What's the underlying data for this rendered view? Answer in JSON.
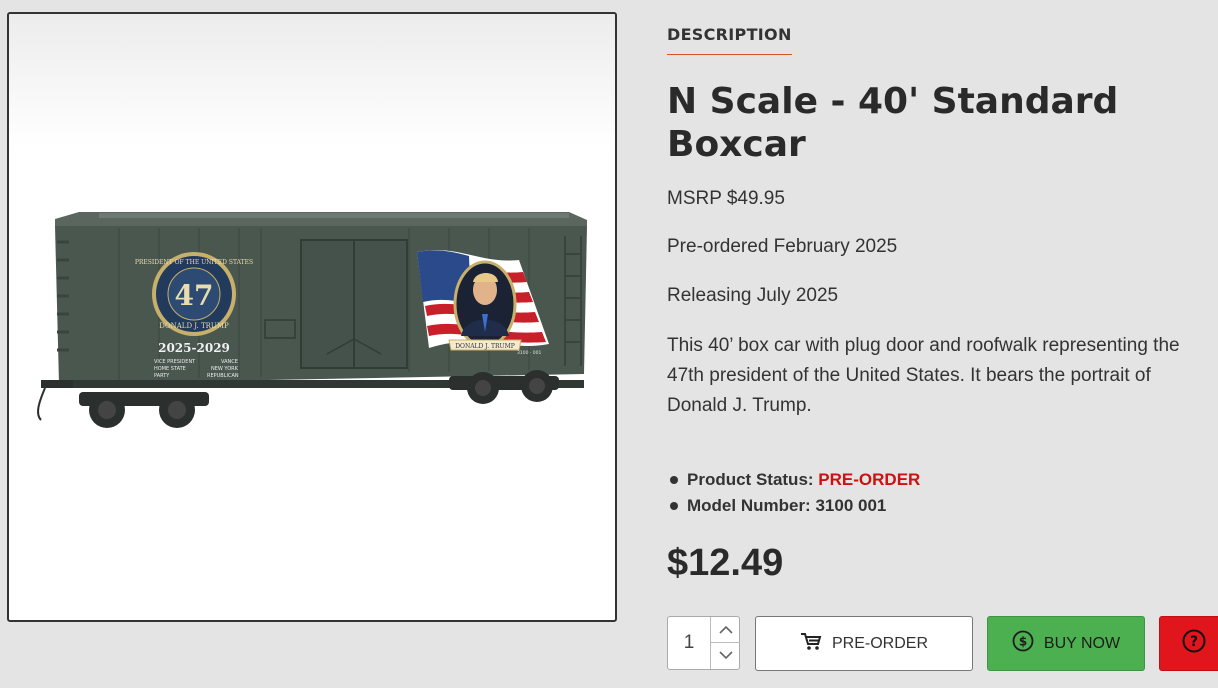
{
  "product_image": {
    "alt": "N Scale 40' Standard Boxcar",
    "car_colors": {
      "body": "#4a574f",
      "dark": "#2f3833",
      "roof": "#57645c"
    },
    "seal_number": "47",
    "seal_ring_text": "PRESIDENT OF THE UNITED STATES",
    "seal_name": "DONALD J. TRUMP",
    "term_years": "2025-2029",
    "data_left": [
      "VICE PRESIDENT",
      "HOME STATE",
      "PARTY"
    ],
    "data_right": [
      "VANCE",
      "NEW YORK",
      "REPUBLICAN"
    ],
    "portrait_caption": "DONALD J. TRUMP",
    "car_number": "3100 · 001"
  },
  "tab": {
    "label": "DESCRIPTION"
  },
  "product": {
    "title": "N Scale - 40' Standard Boxcar",
    "msrp": "MSRP $49.95",
    "preordered": "Pre-ordered February 2025",
    "releasing": "Releasing July 2025",
    "description": "This 40’ box car with plug door and roofwalk representing the 47th president of the United States. It bears the portrait of Donald J. Trump.",
    "status_label": "Product Status:",
    "status_value": "PRE-ORDER",
    "model_label": "Model Number:",
    "model_value": "3100 001",
    "price": "$12.49"
  },
  "controls": {
    "quantity": "1",
    "preorder_label": "PRE-ORDER",
    "buynow_label": "BUY NOW",
    "colors": {
      "buy": "#4caf50",
      "help": "#e0161c",
      "status": "#cc1111"
    }
  }
}
